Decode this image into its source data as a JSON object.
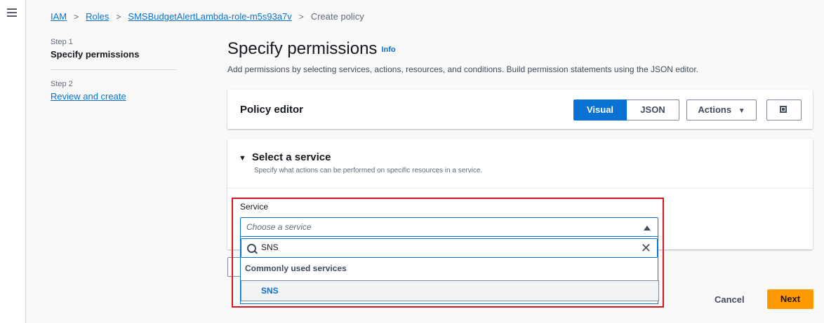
{
  "breadcrumbs": [
    "IAM",
    "Roles",
    "SMSBudgetAlertLambda-role-m5s93a7v",
    "Create policy"
  ],
  "steps": [
    {
      "label": "Step 1",
      "title": "Specify permissions"
    },
    {
      "label": "Step 2",
      "title": "Review and create"
    }
  ],
  "page": {
    "title": "Specify permissions",
    "info": "Info",
    "subtitle": "Add permissions by selecting services, actions, resources, and conditions. Build permission statements using the JSON editor."
  },
  "policy_editor": {
    "title": "Policy editor",
    "visual": "Visual",
    "json": "JSON",
    "actions": "Actions"
  },
  "select_service": {
    "title": "Select a service",
    "description": "Specify what actions can be performed on specific resources in a service.",
    "service_label": "Service",
    "placeholder": "Choose a service",
    "search_value": "SNS",
    "group_heading": "Commonly used services",
    "option": "SNS"
  },
  "footer": {
    "cancel": "Cancel",
    "next": "Next"
  }
}
